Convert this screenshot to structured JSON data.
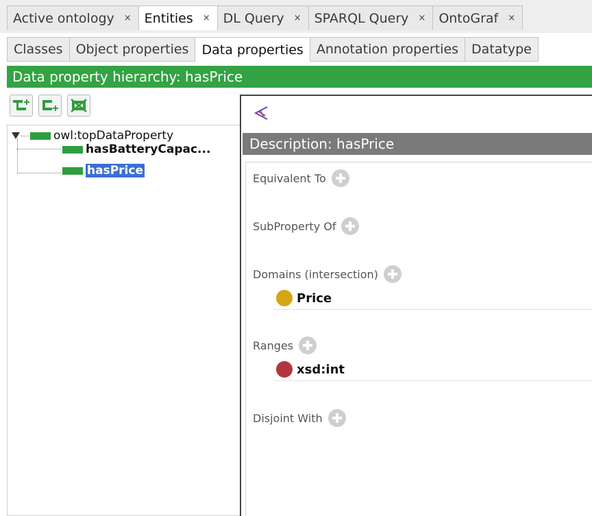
{
  "top_tabs": [
    {
      "label": "Active ontology",
      "close": "×",
      "active": false
    },
    {
      "label": "Entities",
      "close": "×",
      "active": true
    },
    {
      "label": "DL Query",
      "close": "×",
      "active": false
    },
    {
      "label": "SPARQL Query",
      "close": "×",
      "active": false
    },
    {
      "label": "OntoGraf",
      "close": "×",
      "active": false
    }
  ],
  "sub_tabs": [
    {
      "label": "Classes",
      "active": false
    },
    {
      "label": "Object properties",
      "active": false
    },
    {
      "label": "Data properties",
      "active": true
    },
    {
      "label": "Annotation properties",
      "active": false
    },
    {
      "label": "Datatype",
      "active": false
    }
  ],
  "hierarchy": {
    "title": "Data property hierarchy: hasPrice",
    "toolbar": [
      {
        "icon": "add-subproperty-icon"
      },
      {
        "icon": "add-sibling-property-icon"
      },
      {
        "icon": "delete-property-icon"
      }
    ],
    "tree": {
      "root": "owl:topDataProperty",
      "children": [
        "hasBatteryCapac...",
        "hasPrice"
      ],
      "selected": "hasPrice"
    }
  },
  "description": {
    "title": "Description: hasPrice",
    "sections": {
      "equivalent_to": "Equivalent To",
      "subproperty_of": "SubProperty Of",
      "domains": "Domains (intersection)",
      "ranges": "Ranges",
      "disjoint_with": "Disjoint With"
    },
    "domains_items": [
      {
        "label": "Price",
        "color": "#d4a514"
      }
    ],
    "ranges_items": [
      {
        "label": "xsd:int",
        "color": "#b0373e"
      }
    ]
  },
  "colors": {
    "hierarchy_header": "#33a343",
    "description_header": "#7a7a7a",
    "selection": "#3b6fd4",
    "data_property": "#2f9e3e"
  }
}
